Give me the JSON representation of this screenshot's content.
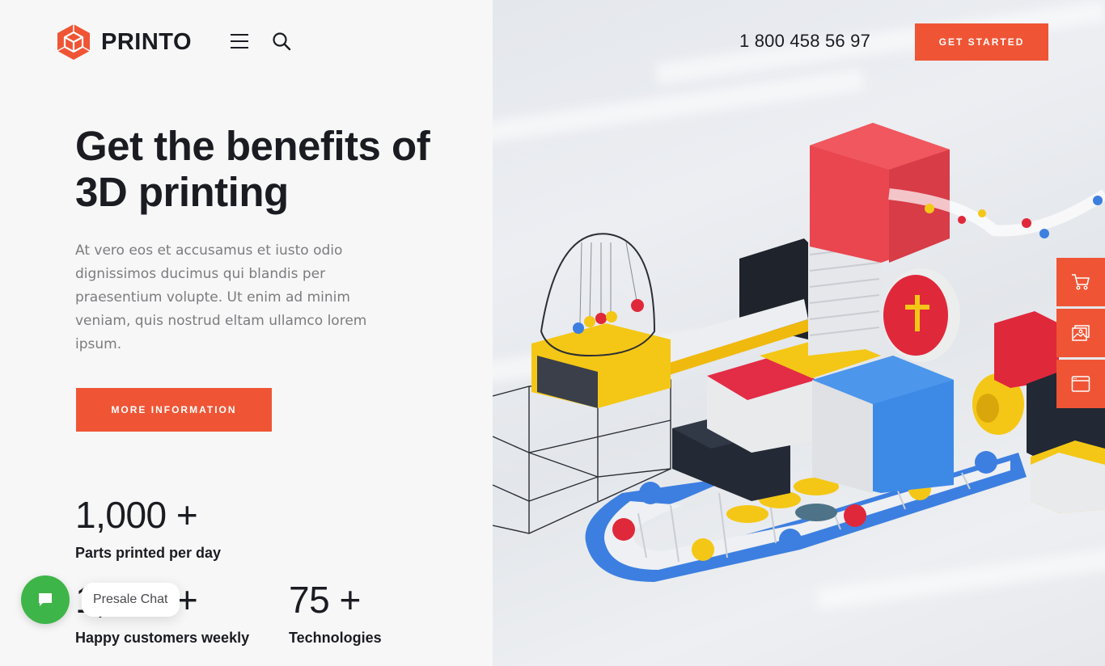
{
  "brand": {
    "name": "PRINTO",
    "color": "#ef5535"
  },
  "header": {
    "menu_icon": "hamburger-icon",
    "search_icon": "search-icon",
    "phone": "1 800 458 56 97",
    "cta_label": "GET STARTED"
  },
  "hero": {
    "title": "Get the benefits of 3D printing",
    "description": "At vero eos et accusamus et iusto odio dignissimos ducimus qui blandis per praesentium volupte. Ut enim ad minim veniam, quis nostrud eltam ullamco lorem ipsum.",
    "button_label": "MORE INFORMATION"
  },
  "stats": [
    {
      "value": "1,000 +",
      "label": "Parts printed per day"
    },
    {
      "value": "1_,_0 +",
      "visible_value": "0 +",
      "label": "Happy customers weekly"
    },
    {
      "value": "75 +",
      "label": "Technologies"
    }
  ],
  "chat": {
    "label": "Presale Chat",
    "icon": "chat-bubble-icon",
    "color": "#3eb548"
  },
  "side_toolbar": [
    {
      "icon": "cart-icon"
    },
    {
      "icon": "gallery-icon"
    },
    {
      "icon": "browser-window-icon"
    }
  ],
  "illustration": {
    "subject": "isometric 3D printing factory with conveyor belts and light bulbs"
  }
}
